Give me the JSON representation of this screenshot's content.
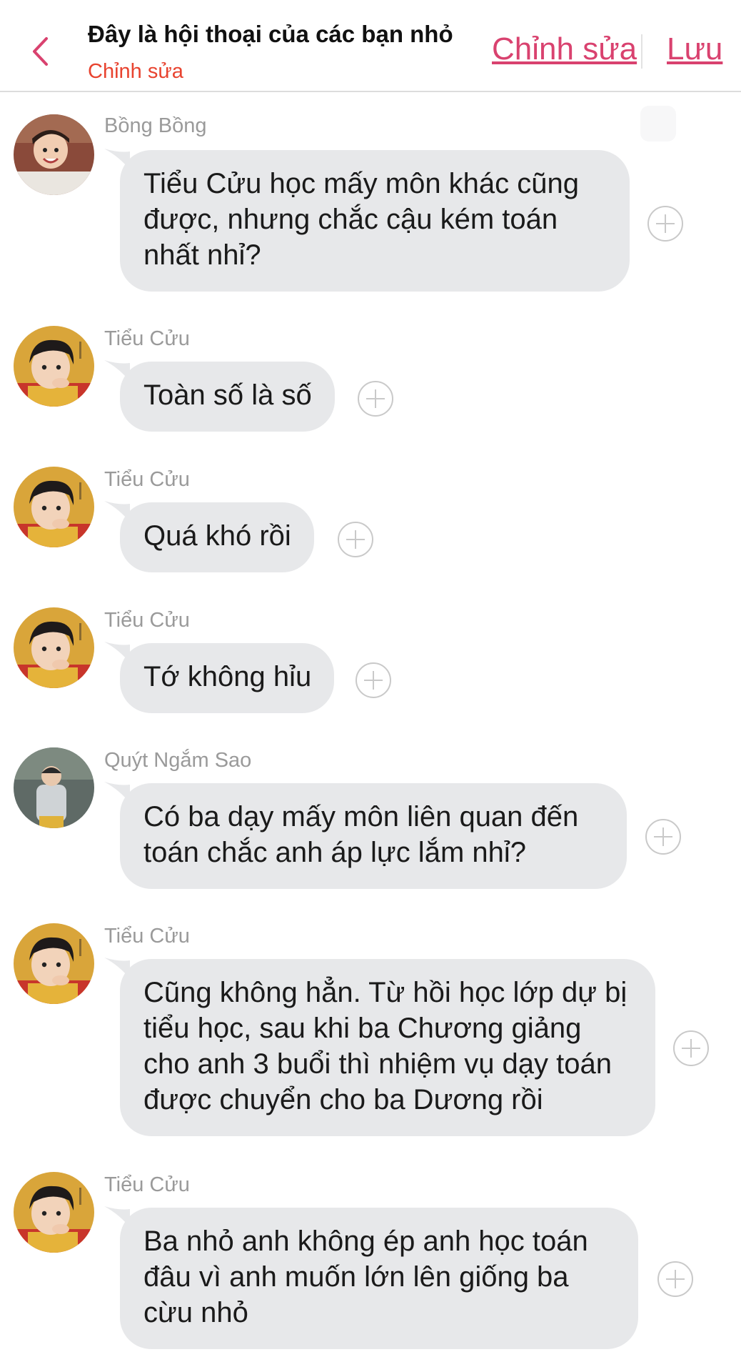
{
  "header": {
    "title": "Đây là hội thoại của các bạn nhỏ",
    "subtitle": "Chỉnh sửa",
    "edit_label": "Chỉnh sửa",
    "save_label": "Lưu"
  },
  "messages": [
    {
      "sender": "Bồng Bồng",
      "text": "Tiểu Cửu học mấy môn khác cũng được, nhưng chắc cậu kém toán nhất nhỉ?",
      "avatar": "child-photo-bong-bong"
    },
    {
      "sender": "Tiểu Cửu",
      "text": "Toàn số là số",
      "avatar": "child-photo-tieu-cuu"
    },
    {
      "sender": "Tiểu Cửu",
      "text": "Quá khó rồi",
      "avatar": "child-photo-tieu-cuu"
    },
    {
      "sender": "Tiểu Cửu",
      "text": "Tớ không hỉu",
      "avatar": "child-photo-tieu-cuu"
    },
    {
      "sender": "Quýt Ngắm Sao",
      "text": "Có ba dạy mấy môn liên quan đến toán chắc anh áp lực lắm nhỉ?",
      "avatar": "child-photo-quyt-ngam-sao"
    },
    {
      "sender": "Tiểu Cửu",
      "text": "Cũng không hẳn. Từ hồi học lớp dự bị tiểu học, sau khi ba Chương giảng cho anh 3 buổi thì nhiệm vụ dạy toán được chuyển cho ba Dương rồi",
      "avatar": "child-photo-tieu-cuu"
    },
    {
      "sender": "Tiểu Cửu",
      "text": "Ba nhỏ anh không ép anh học toán đâu vì anh muốn lớn lên giống ba cừu nhỏ",
      "avatar": "child-photo-tieu-cuu"
    }
  ],
  "icons": {
    "back": "chevron-left-icon",
    "add": "plus-circle-icon"
  },
  "colors": {
    "accent": "#d9426f",
    "subtitle": "#e8432f",
    "bubble": "#e7e8ea",
    "sender": "#9a9a9a"
  }
}
